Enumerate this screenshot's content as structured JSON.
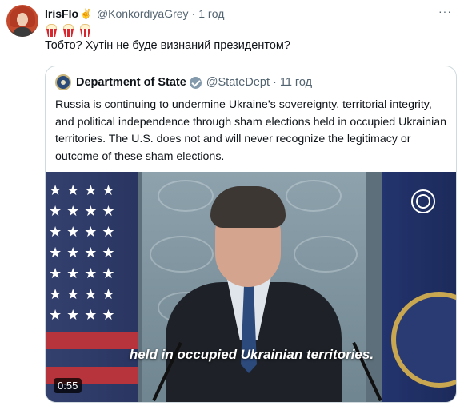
{
  "tweet": {
    "author_name": "IrisFlo",
    "author_emoji": "✌️",
    "author_handle": "@KonkordiyaGrey",
    "separator": "·",
    "time": "1 год",
    "text": "Тобто? Хутін не буде визнаний президентом?",
    "emoji_count": 3
  },
  "quoted": {
    "author_name": "Department of State",
    "author_handle": "@StateDept",
    "separator": "·",
    "time": "11 год",
    "text": "Russia is continuing to undermine Ukraine’s sovereignty, territorial integrity, and political independence through sham elections held in occupied Ukrainian territories. The U.S. does not and will never recognize the legitimacy or outcome of these sham elections.",
    "video": {
      "subtitle": "held in occupied Ukrainian territories.",
      "duration": "0:55"
    }
  },
  "icons": {
    "more": "more-dots-icon",
    "verified": "verified-badge-icon",
    "popcorn": "popcorn-icon"
  },
  "colors": {
    "text": "#0f1419",
    "secondary": "#536471",
    "border": "#cfd9de"
  }
}
